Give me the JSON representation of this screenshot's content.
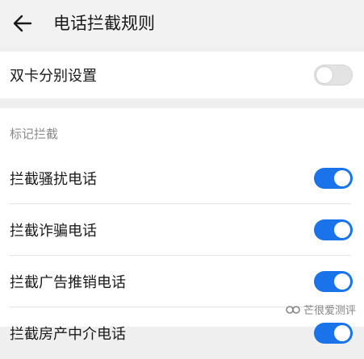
{
  "header": {
    "title": "电话拦截规则",
    "back_icon": "arrow-left-icon"
  },
  "dual_sim": {
    "label": "双卡分别设置",
    "enabled": false
  },
  "section": {
    "title": "标记拦截",
    "items": [
      {
        "label": "拦截骚扰电话",
        "enabled": true
      },
      {
        "label": "拦截诈骗电话",
        "enabled": true
      },
      {
        "label": "拦截广告推销电话",
        "enabled": true
      },
      {
        "label": "拦截房产中介电话",
        "enabled": true
      }
    ]
  },
  "watermark": {
    "text": "芒很爱测评"
  },
  "colors": {
    "accent": "#1a73e8",
    "background": "#efefef"
  }
}
